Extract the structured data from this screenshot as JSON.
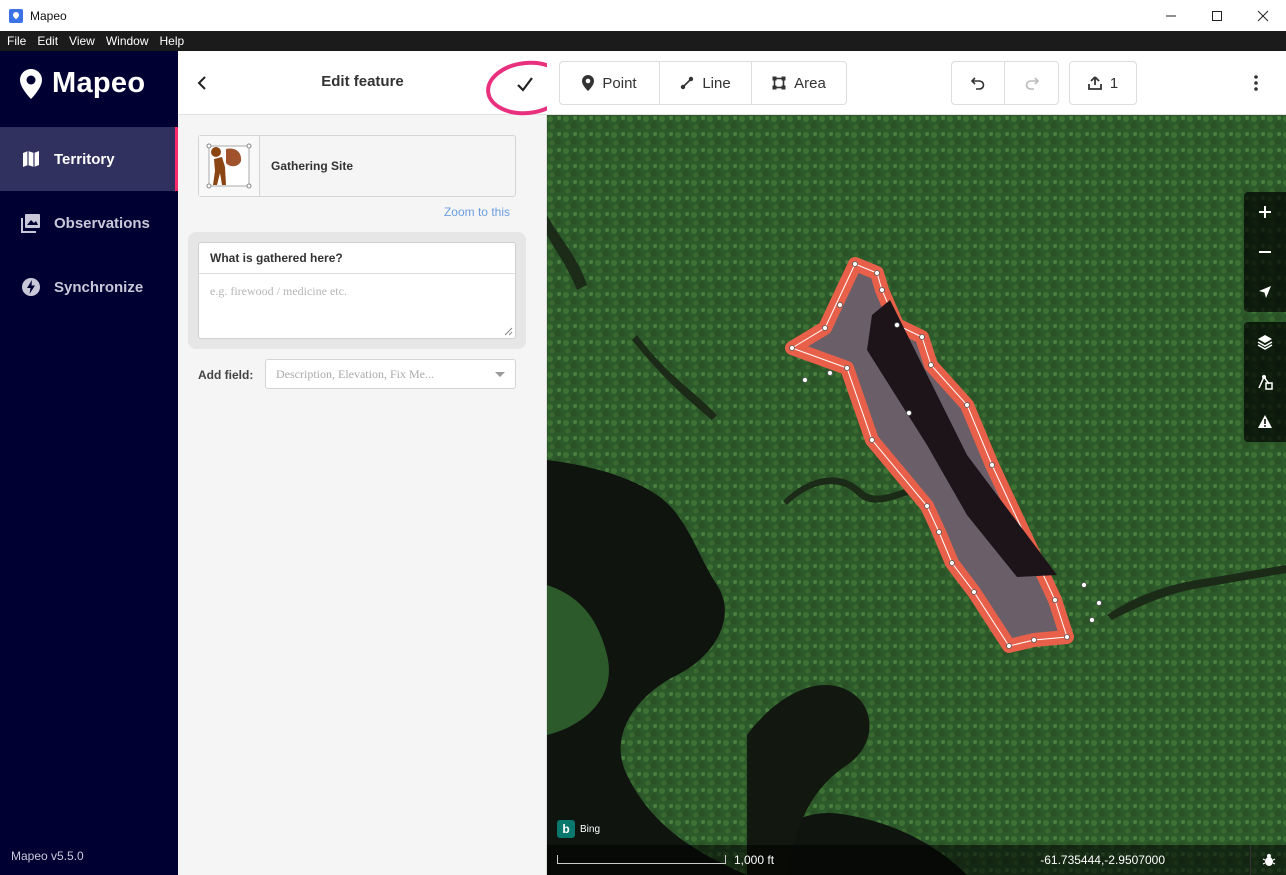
{
  "window": {
    "title": "Mapeo",
    "controls": [
      "minimize",
      "maximize",
      "close"
    ]
  },
  "menu": [
    "File",
    "Edit",
    "View",
    "Window",
    "Help"
  ],
  "sidebar": {
    "logo_text": "Mapeo",
    "items": [
      {
        "label": "Territory",
        "icon": "map-icon",
        "active": true
      },
      {
        "label": "Observations",
        "icon": "photos-icon",
        "active": false
      },
      {
        "label": "Synchronize",
        "icon": "lightning-icon",
        "active": false
      }
    ],
    "version": "Mapeo v5.5.0"
  },
  "panel": {
    "title": "Edit feature",
    "preset_label": "Gathering Site",
    "zoom_link": "Zoom to this",
    "field": {
      "label": "What is gathered here?",
      "placeholder": "e.g. firewood / medicine etc."
    },
    "add_field_label": "Add field:",
    "add_field_placeholder": "Description, Elevation, Fix Me..."
  },
  "toolbar": {
    "point_label": "Point",
    "line_label": "Line",
    "area_label": "Area",
    "upload_count": "1"
  },
  "map": {
    "attribution": "Bing",
    "scale_label": "1,000 ft",
    "coordinates": "-61.735444,-2.9507000"
  },
  "colors": {
    "sidebar_bg": "#000033",
    "active_accent": "#ff2c6d",
    "area_outline": "#e8604a",
    "highlight": "#e8307e"
  }
}
